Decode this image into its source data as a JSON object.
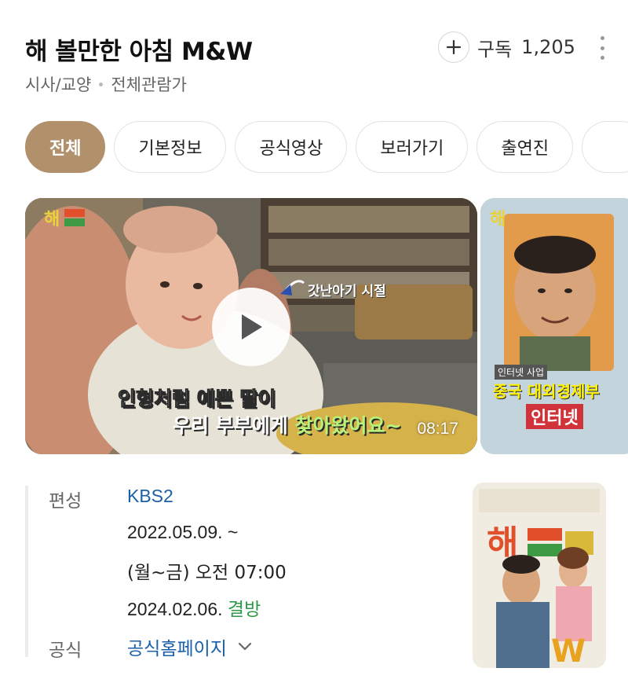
{
  "header": {
    "title": "해 볼만한 아침 M&W",
    "genre": "시사/교양",
    "rating": "전체관람가",
    "subscribe_label": "구독",
    "subscribe_count": "1,205"
  },
  "tabs": [
    {
      "label": "전체",
      "active": true
    },
    {
      "label": "기본정보",
      "active": false
    },
    {
      "label": "공식영상",
      "active": false
    },
    {
      "label": "보러가기",
      "active": false
    },
    {
      "label": "출연진",
      "active": false
    }
  ],
  "videos": [
    {
      "duration": "08:17",
      "captions": [
        "갓난아기 시절",
        "인형처럼 예쁜 딸이",
        "우리 부부에게",
        "찾아왔어요~"
      ]
    },
    {
      "captions": [
        "인터넷 사업",
        "중국 대외경제부",
        "인터넷"
      ]
    }
  ],
  "info": {
    "broadcast_label": "편성",
    "channel": "KBS2",
    "start_date": "2022.05.09. ~",
    "schedule": "(월~금) 오전 07:00",
    "end_date": "2024.02.06.",
    "status": "결방",
    "official_label": "공식",
    "homepage_link": "공식홈페이지"
  },
  "colors": {
    "active_tab": "#b1906c",
    "link": "#1a5fa8",
    "status_green": "#2e9a48"
  },
  "icons": [
    "plus-icon",
    "more-vertical-icon",
    "play-icon",
    "chevron-down-icon"
  ]
}
